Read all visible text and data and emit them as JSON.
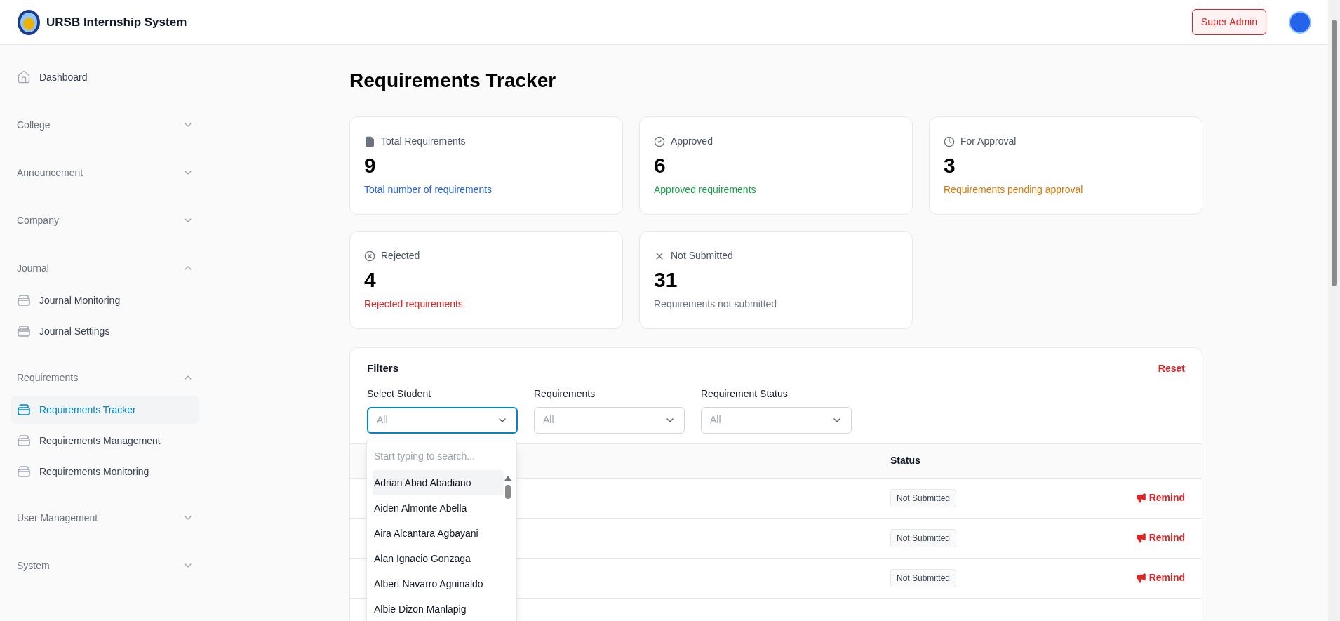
{
  "header": {
    "title": "URSB Internship System",
    "role_badge": "Super Admin"
  },
  "sidebar": {
    "items": [
      {
        "kind": "link",
        "label": "Dashboard",
        "selected": false
      },
      {
        "kind": "section",
        "label": "College",
        "expanded": false
      },
      {
        "kind": "section",
        "label": "Announcement",
        "expanded": false
      },
      {
        "kind": "section",
        "label": "Company",
        "expanded": false
      },
      {
        "kind": "section",
        "label": "Journal",
        "expanded": true,
        "children": [
          {
            "label": "Journal Monitoring",
            "selected": false
          },
          {
            "label": "Journal Settings",
            "selected": false
          }
        ]
      },
      {
        "kind": "section",
        "label": "Requirements",
        "expanded": true,
        "children": [
          {
            "label": "Requirements Tracker",
            "selected": true
          },
          {
            "label": "Requirements Management",
            "selected": false
          },
          {
            "label": "Requirements Monitoring",
            "selected": false
          }
        ]
      },
      {
        "kind": "section",
        "label": "User Management",
        "expanded": false
      },
      {
        "kind": "section",
        "label": "System",
        "expanded": false
      }
    ]
  },
  "page_title": "Requirements Tracker",
  "stat_cards": [
    {
      "kind": "total",
      "label": "Total Requirements",
      "value": "9",
      "caption": "Total number of requirements",
      "color": "#2563eb"
    },
    {
      "kind": "approved",
      "label": "Approved",
      "value": "6",
      "caption": "Approved requirements",
      "color": "#16a34a"
    },
    {
      "kind": "pending",
      "label": "For Approval",
      "value": "3",
      "caption": "Requirements pending approval",
      "color": "#d97706"
    },
    {
      "kind": "rejected",
      "label": "Rejected",
      "value": "4",
      "caption": "Rejected requirements",
      "color": "#dc2626"
    },
    {
      "kind": "missing",
      "label": "Not Submitted",
      "value": "31",
      "caption": "Requirements not submitted",
      "color": "#6b7280"
    }
  ],
  "filters": {
    "title": "Filters",
    "reset": "Reset",
    "fields": [
      {
        "label": "Select Student",
        "placeholder": "All",
        "focused": true
      },
      {
        "label": "Requirements",
        "placeholder": "All",
        "focused": false
      },
      {
        "label": "Requirement Status",
        "placeholder": "All",
        "focused": false
      }
    ]
  },
  "student_dropdown": {
    "placeholder": "Start typing to search...",
    "options": [
      {
        "label": "Adrian Abad Abadiano",
        "selected": true
      },
      {
        "label": "Aiden Almonte Abella",
        "selected": false
      },
      {
        "label": "Aira Alcantara Agbayani",
        "selected": false
      },
      {
        "label": "Alan Ignacio Gonzaga",
        "selected": false
      },
      {
        "label": "Albert Navarro Aguinaldo",
        "selected": false
      },
      {
        "label": "Albie Dizon Manlapig",
        "selected": false
      }
    ]
  },
  "table": {
    "columns": [
      {
        "label": "Status"
      }
    ],
    "rows": [
      {
        "status": "Not Submitted",
        "action": "Remind"
      },
      {
        "status": "Not Submitted",
        "action": "Remind"
      },
      {
        "status": "Not Submitted",
        "action": "Remind"
      }
    ]
  }
}
